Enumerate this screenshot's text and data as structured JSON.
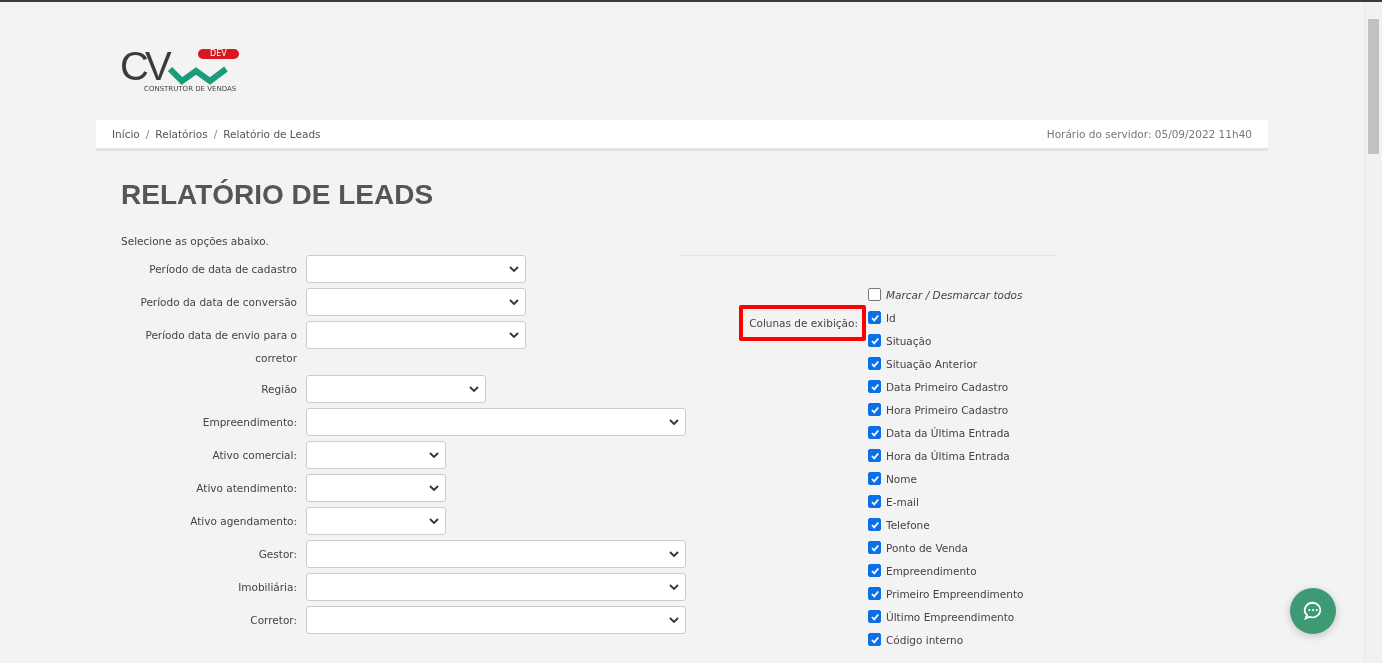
{
  "logo": {
    "mark": "CV",
    "badge": "DEV",
    "tagline": "CONSTRUTOR DE VENDAS"
  },
  "breadcrumb": [
    {
      "kind": "link",
      "text": "Início"
    },
    {
      "kind": "separator",
      "text": "/"
    },
    {
      "kind": "link",
      "text": "Relatórios"
    },
    {
      "kind": "separator",
      "text": "/"
    },
    {
      "kind": "link",
      "text": "Relatório de Leads"
    }
  ],
  "server_time": "Horário do servidor: 05/09/2022 11h40",
  "title": "RELATÓRIO DE LEADS",
  "subtitle": "Selecione as opções abaixo.",
  "filters": [
    {
      "label": "Período de data de cadastro",
      "kind": "medium"
    },
    {
      "label": "Período da data de conversão",
      "kind": "medium"
    },
    {
      "label": "Período data de envio para o corretor",
      "kind": "medium"
    },
    {
      "label": "Região",
      "kind": "small"
    },
    {
      "label": "Empreendimento:",
      "kind": "wide"
    },
    {
      "label": "Ativo comercial:",
      "kind": "narrow"
    },
    {
      "label": "Ativo atendimento:",
      "kind": "narrow"
    },
    {
      "label": "Ativo agendamento:",
      "kind": "narrow"
    },
    {
      "label": "Gestor:",
      "kind": "wide"
    },
    {
      "label": "Imobiliária:",
      "kind": "wide"
    },
    {
      "label": "Corretor:",
      "kind": "wide"
    }
  ],
  "columns_section": {
    "label": "Colunas de exibição:",
    "highlighted": true,
    "toggle_all": {
      "label": "Marcar / Desmarcar todos",
      "checked": false
    },
    "options": [
      {
        "label": "Id",
        "checked": true
      },
      {
        "label": "Situação",
        "checked": true
      },
      {
        "label": "Situação Anterior",
        "checked": true
      },
      {
        "label": "Data Primeiro Cadastro",
        "checked": true
      },
      {
        "label": "Hora Primeiro Cadastro",
        "checked": true
      },
      {
        "label": "Data da Última Entrada",
        "checked": true
      },
      {
        "label": "Hora da Última Entrada",
        "checked": true
      },
      {
        "label": "Nome",
        "checked": true
      },
      {
        "label": "E-mail",
        "checked": true
      },
      {
        "label": "Telefone",
        "checked": true
      },
      {
        "label": "Ponto de Venda",
        "checked": true
      },
      {
        "label": "Empreendimento",
        "checked": true
      },
      {
        "label": "Primeiro Empreendimento",
        "checked": true
      },
      {
        "label": "Último Empreendimento",
        "checked": true
      },
      {
        "label": "Código interno",
        "checked": true
      }
    ]
  }
}
